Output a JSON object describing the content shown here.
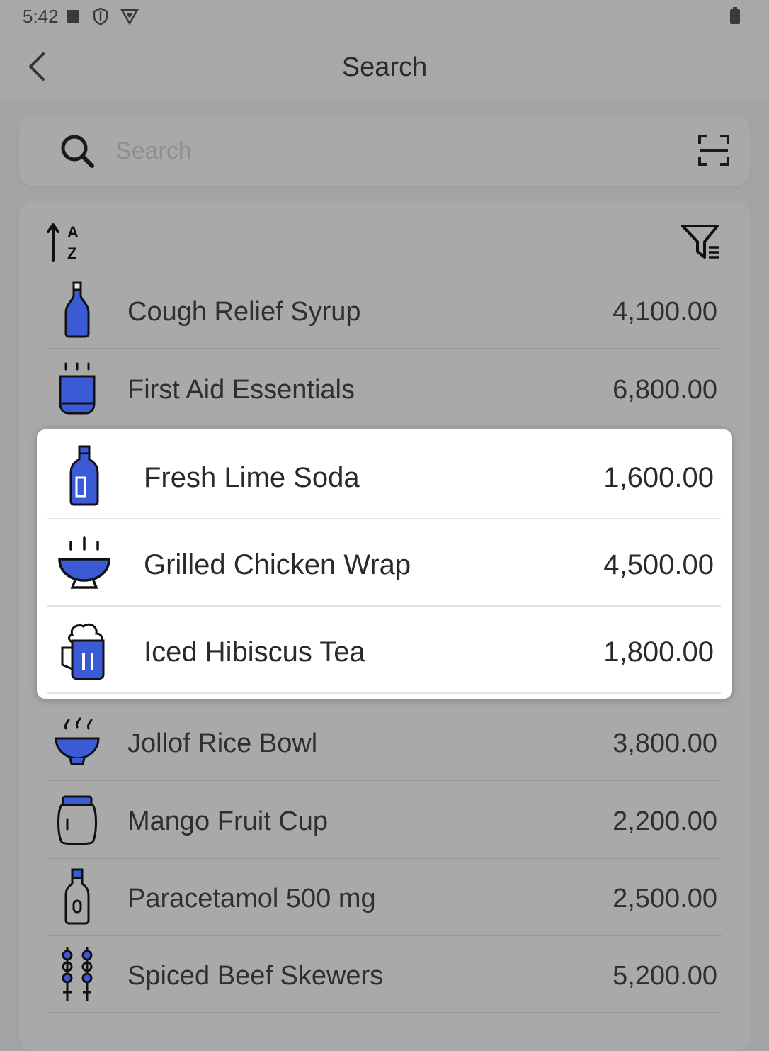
{
  "status_bar": {
    "time": "5:42"
  },
  "header": {
    "title": "Search"
  },
  "search": {
    "placeholder": "Search",
    "value": ""
  },
  "items": [
    {
      "name": "Cough Relief Syrup",
      "price": "4,100.00",
      "icon": "syrup-bottle-icon"
    },
    {
      "name": "First Aid Essentials",
      "price": "6,800.00",
      "icon": "cup-icon"
    },
    {
      "name": "Fresh Lime Soda",
      "price": "1,600.00",
      "icon": "soda-bottle-icon"
    },
    {
      "name": "Grilled Chicken Wrap",
      "price": "4,500.00",
      "icon": "bowl-icon"
    },
    {
      "name": "Iced Hibiscus Tea",
      "price": "1,800.00",
      "icon": "mug-icon"
    },
    {
      "name": "Jollof Rice Bowl",
      "price": "3,800.00",
      "icon": "rice-bowl-icon"
    },
    {
      "name": "Mango Fruit Cup",
      "price": "2,200.00",
      "icon": "jar-icon"
    },
    {
      "name": "Paracetamol 500 mg",
      "price": "2,500.00",
      "icon": "pill-bottle-icon"
    },
    {
      "name": "Spiced Beef Skewers",
      "price": "5,200.00",
      "icon": "skewers-icon"
    }
  ],
  "colors": {
    "accent": "#3b5bd6",
    "icon_outline": "#111111",
    "overlay": "#a3a3a3",
    "highlight_bg": "#ffffff"
  }
}
